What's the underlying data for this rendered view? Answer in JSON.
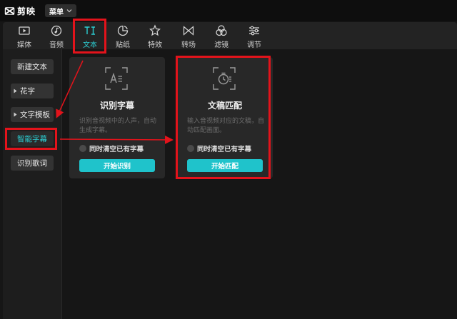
{
  "app": {
    "name": "剪映",
    "menu_label": "菜单"
  },
  "toolbar": {
    "tools": [
      {
        "label": "媒体",
        "icon": "media-icon"
      },
      {
        "label": "音频",
        "icon": "audio-icon"
      },
      {
        "label": "文本",
        "icon": "text-icon",
        "active": true
      },
      {
        "label": "贴纸",
        "icon": "sticker-icon"
      },
      {
        "label": "特效",
        "icon": "effects-icon"
      },
      {
        "label": "转场",
        "icon": "transition-icon"
      },
      {
        "label": "滤镜",
        "icon": "filter-icon"
      },
      {
        "label": "调节",
        "icon": "adjust-icon"
      }
    ]
  },
  "sidebar": {
    "items": [
      {
        "label": "新建文本"
      },
      {
        "label": "花字",
        "expandable": true
      },
      {
        "label": "文字模板",
        "expandable": true
      },
      {
        "label": "智能字幕",
        "active": true
      },
      {
        "label": "识别歌词"
      }
    ]
  },
  "cards": [
    {
      "title": "识别字幕",
      "icon": "subtitle-recognize-icon",
      "description": "识别音视频中的人声，自动生成字幕。",
      "checkbox_label": "同时清空已有字幕",
      "button_label": "开始识别"
    },
    {
      "title": "文稿匹配",
      "icon": "script-match-icon",
      "description": "输入音视频对应的文稿，自动匹配画面。",
      "checkbox_label": "同时清空已有字幕",
      "button_label": "开始匹配"
    }
  ],
  "colors": {
    "accent": "#2ccfd4",
    "button": "#1fc3cb",
    "highlight": "#e3131b"
  }
}
